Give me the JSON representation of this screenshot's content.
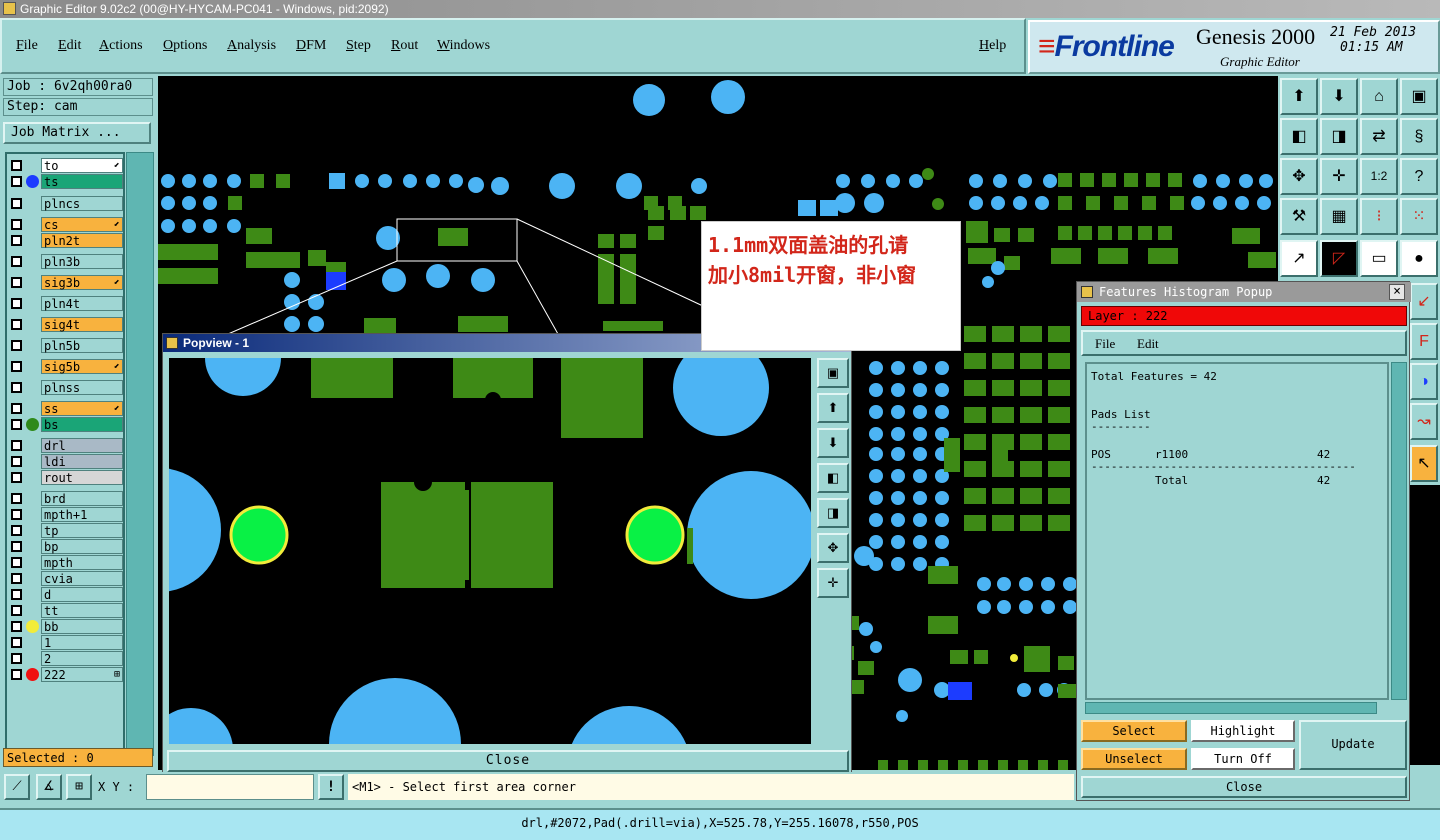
{
  "window": {
    "title": "Graphic Editor 9.02c2 (00@HY-HYCAM-PC041 - Windows, pid:2092)"
  },
  "menu": [
    "File",
    "Edit",
    "Actions",
    "Options",
    "Analysis",
    "DFM",
    "Step",
    "Rout",
    "Windows"
  ],
  "help": "Help",
  "brand": {
    "name": "Frontline",
    "product": "Genesis 2000",
    "subtitle": "Graphic Editor",
    "date": "21 Feb 2013",
    "time": "01:15 AM"
  },
  "job": {
    "job_label": "Job : 6v2qh00ra0",
    "step_label": "Step: cam",
    "matrix_button": "Job Matrix ..."
  },
  "layers": [
    {
      "name": "to",
      "dot": "",
      "bg": "#ffffff",
      "mark": "⬋"
    },
    {
      "name": "ts",
      "dot": "#1c3cff",
      "bg": "#1aa577",
      "mark": ""
    },
    {
      "name": "plncs",
      "dot": "",
      "bg": "#9fd6d3",
      "mark": ""
    },
    {
      "name": "cs",
      "dot": "",
      "bg": "#f8b23e",
      "mark": "⬋"
    },
    {
      "name": "pln2t",
      "dot": "",
      "bg": "#f8b23e",
      "mark": ""
    },
    {
      "name": "pln3b",
      "dot": "",
      "bg": "#9fd6d3",
      "mark": ""
    },
    {
      "name": "sig3b",
      "dot": "",
      "bg": "#f8b23e",
      "mark": "⬋"
    },
    {
      "name": "pln4t",
      "dot": "",
      "bg": "#9fd6d3",
      "mark": ""
    },
    {
      "name": "sig4t",
      "dot": "",
      "bg": "#f8b23e",
      "mark": ""
    },
    {
      "name": "pln5b",
      "dot": "",
      "bg": "#9fd6d3",
      "mark": ""
    },
    {
      "name": "sig5b",
      "dot": "",
      "bg": "#f8b23e",
      "mark": "⬋"
    },
    {
      "name": "plnss",
      "dot": "",
      "bg": "#9fd6d3",
      "mark": ""
    },
    {
      "name": "ss",
      "dot": "",
      "bg": "#f8b23e",
      "mark": "⬋"
    },
    {
      "name": "bs",
      "dot": "#2f8a1a",
      "bg": "#1aa577",
      "mark": ""
    },
    {
      "name": "drl",
      "dot": "",
      "bg": "#a9b9c6",
      "mark": ""
    },
    {
      "name": "ldi",
      "dot": "",
      "bg": "#a9b9c6",
      "mark": ""
    },
    {
      "name": "rout",
      "dot": "",
      "bg": "#d6d6d6",
      "mark": ""
    },
    {
      "name": "brd",
      "dot": "",
      "bg": "#9fd6d3",
      "mark": ""
    },
    {
      "name": "mpth+1",
      "dot": "",
      "bg": "#9fd6d3",
      "mark": ""
    },
    {
      "name": "tp",
      "dot": "",
      "bg": "#9fd6d3",
      "mark": ""
    },
    {
      "name": "bp",
      "dot": "",
      "bg": "#9fd6d3",
      "mark": ""
    },
    {
      "name": "mpth",
      "dot": "",
      "bg": "#9fd6d3",
      "mark": ""
    },
    {
      "name": "cvia",
      "dot": "",
      "bg": "#9fd6d3",
      "mark": ""
    },
    {
      "name": "d",
      "dot": "",
      "bg": "#9fd6d3",
      "mark": ""
    },
    {
      "name": "tt",
      "dot": "",
      "bg": "#9fd6d3",
      "mark": ""
    },
    {
      "name": "bb",
      "dot": "#f2ec3a",
      "bg": "#9fd6d3",
      "mark": ""
    },
    {
      "name": "1",
      "dot": "",
      "bg": "#9fd6d3",
      "mark": ""
    },
    {
      "name": "2",
      "dot": "",
      "bg": "#9fd6d3",
      "mark": ""
    },
    {
      "name": "222",
      "dot": "#f01010",
      "bg": "#9fd6d3",
      "mark": "⊞"
    }
  ],
  "selected": "Selected : 0",
  "popview": {
    "title": "Popview - 1",
    "close": "Close"
  },
  "annotation": {
    "line1": "1.1mm双面盖油的孔请",
    "line2": "加小8mil开窗，非小窗"
  },
  "histogram": {
    "title": "Features Histogram Popup",
    "close_x": "×",
    "layer": "Layer :  222",
    "menu": [
      "File",
      "Edit"
    ],
    "total_features": "Total Features = 42",
    "pads_list": "Pads List",
    "underline_short": "---------",
    "pos_label": "POS",
    "pos_symbol": "r1100",
    "pos_count": "42",
    "underline_long": "----------------------------------------",
    "total_label": "Total",
    "total_count": "42",
    "select": "Select",
    "highlight": "Highlight",
    "update": "Update",
    "unselect": "Unselect",
    "turn_off": "Turn Off",
    "close": "Close"
  },
  "bottom": {
    "xy_label": "X Y :",
    "xy_value": "",
    "alert": "!",
    "prompt": "<M1> - Select first area corner"
  },
  "status": "drl,#2072,Pad(.drill=via),X=525.78,Y=255.16078,r550,POS",
  "colors": {
    "pad_blue": "#4cb4f4",
    "pad_green": "#3e8a16",
    "drill_green": "#09f145",
    "drill_ring": "#f2ec3a",
    "canvas": "#000000",
    "panel": "#9fd6d3",
    "highlight_orange": "#f8b23e",
    "layer_red": "#f01010"
  }
}
